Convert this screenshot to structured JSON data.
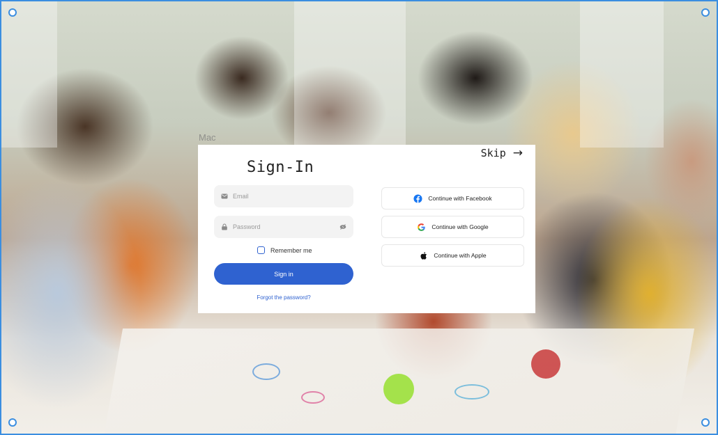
{
  "watermark": "Mac",
  "skip": {
    "label": "Skip",
    "arrow": "→"
  },
  "title": "Sign-In",
  "form": {
    "email_placeholder": "Email",
    "password_placeholder": "Password",
    "remember_label": "Remember me",
    "signin_label": "Sign in",
    "forgot_label": "Forgot the password?"
  },
  "social": {
    "facebook": "Continue with Facebook",
    "google": "Continue with Google",
    "apple": "Continue with Apple"
  },
  "icons": {
    "email": "mail-icon",
    "password": "lock-icon",
    "toggle": "eye-off-icon",
    "facebook": "facebook-icon",
    "google": "google-icon",
    "apple": "apple-icon"
  },
  "colors": {
    "primary": "#2f62d0",
    "frame": "#3b8ee0",
    "facebook": "#1877f2"
  }
}
